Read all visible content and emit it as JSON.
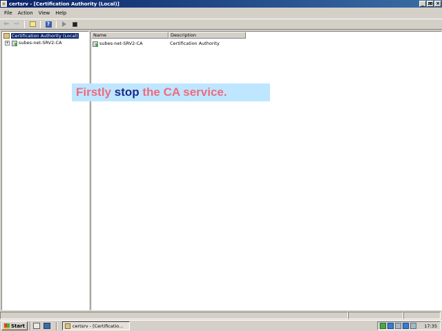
{
  "window": {
    "title": "certsrv - [Certification Authority (Local)]",
    "min_glyph": "_",
    "max_glyph": "æ",
    "close_glyph": "×"
  },
  "menu": [
    "File",
    "Action",
    "View",
    "Help"
  ],
  "toolbar": {
    "back_glyph": "⇦",
    "forward_glyph": "⇨",
    "help_glyph": "?"
  },
  "tree": {
    "root_label": "Certification Authority (Local)",
    "child_label": "subes-net-SRV2-CA",
    "expander_glyph": "+"
  },
  "list": {
    "columns": [
      "Name",
      "Description"
    ],
    "rows": [
      {
        "name": "subes-net-SRV2-CA",
        "description": "Certification Authority"
      }
    ]
  },
  "overlay": {
    "part1": "Firstly",
    "part2": "stop",
    "part3": "the CA service."
  },
  "taskbar": {
    "start_label": "Start",
    "task_label": "certsrv - [Certificatio...",
    "clock": "17:35"
  },
  "colors": {
    "titlebar": "#0a246a",
    "selection": "#0a246a",
    "overlay_bg": "#bfe6ff",
    "overlay_pink": "#ee6b7f",
    "overlay_navy": "#1b2a8a"
  }
}
